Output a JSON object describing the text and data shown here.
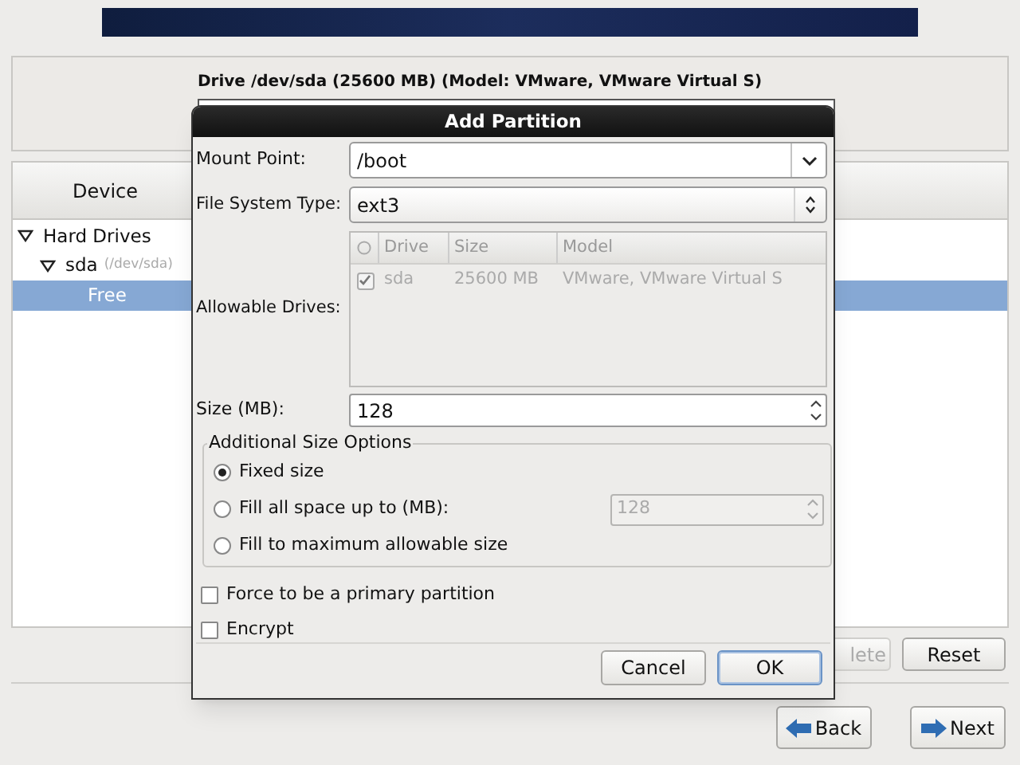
{
  "drive": {
    "title": "Drive /dev/sda (25600 MB) (Model: VMware, VMware Virtual S)"
  },
  "device_tree": {
    "column": "Device",
    "items": [
      {
        "label": "Hard Drives",
        "expanded": true,
        "selected": false,
        "children": [
          {
            "label": "sda",
            "detail": "(/dev/sda)",
            "expanded": true,
            "selected": false,
            "children": [
              {
                "label": "Free",
                "selected": true
              }
            ]
          }
        ]
      }
    ]
  },
  "buttons": [
    {
      "label": "lete",
      "disabled": true
    },
    {
      "label": "Reset",
      "disabled": false
    }
  ],
  "nav_buttons": [
    {
      "label": "Back",
      "kind": "back"
    },
    {
      "label": "Next",
      "kind": "next"
    }
  ],
  "dialog": {
    "title": "Add Partition",
    "mount_point": {
      "label": "Mount Point:",
      "value": "/boot"
    },
    "fs_type": {
      "label": "File System Type:",
      "value": "ext3"
    },
    "allowable_drives": {
      "label": "Allowable Drives:",
      "columns": [
        "Drive",
        "Size",
        "Model"
      ],
      "rows": [
        {
          "checked": true,
          "cells": [
            "sda",
            "25600 MB",
            "VMware, VMware Virtual S"
          ]
        }
      ]
    },
    "size": {
      "label": "Size (MB):",
      "value": "128"
    },
    "size_options": {
      "title": "Additional Size Options",
      "options": [
        {
          "label": "Fixed size",
          "selected": true
        },
        {
          "label": "Fill all space up to (MB):",
          "selected": false,
          "value": "128"
        },
        {
          "label": "Fill to maximum allowable size",
          "selected": false
        }
      ]
    },
    "checkboxes": [
      {
        "label": "Force to be a primary partition",
        "checked": false
      },
      {
        "label": "Encrypt",
        "checked": false
      }
    ],
    "buttons": [
      {
        "label": "Cancel",
        "default": false
      },
      {
        "label": "OK",
        "default": true
      }
    ]
  }
}
